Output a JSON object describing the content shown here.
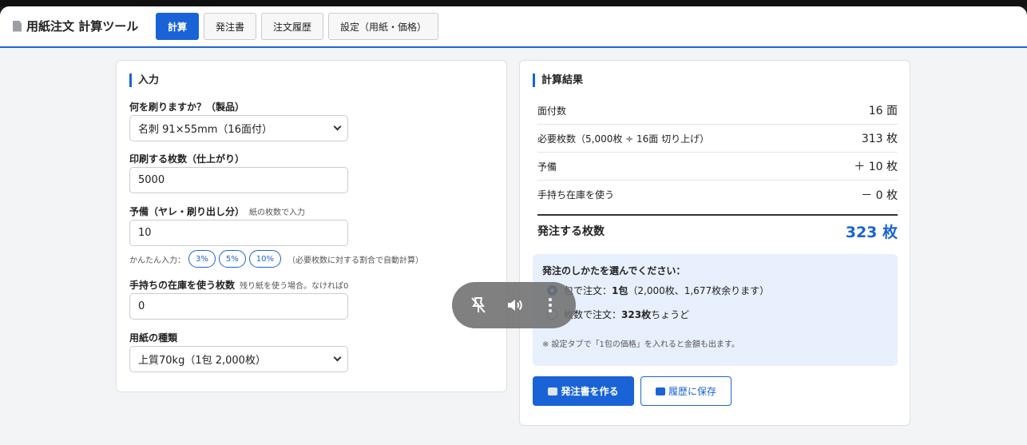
{
  "app": {
    "title": "用紙注文 計算ツール"
  },
  "tabs": [
    {
      "label": "計算",
      "active": true
    },
    {
      "label": "発注書",
      "active": false
    },
    {
      "label": "注文履歴",
      "active": false
    },
    {
      "label": "設定（用紙・価格）",
      "active": false
    }
  ],
  "input": {
    "title": "入力",
    "product_label": "何を刷りますか？（製品）",
    "product_value": "名刺 91×55mm（16面付）",
    "qty_label": "印刷する枚数（仕上がり）",
    "qty_value": "5000",
    "spare_label": "予備（ヤレ・刷り出し分）",
    "spare_hint": "紙の枚数で入力",
    "spare_value": "10",
    "quick_label": "かんたん入力：",
    "quick_options": [
      "3%",
      "5%",
      "10%"
    ],
    "quick_note": "（必要枚数に対する割合で自動計算）",
    "stock_label": "手持ちの在庫を使う枚数",
    "stock_hint": "残り紙を使う場合。なければ0",
    "stock_value": "0",
    "paper_label": "用紙の種類",
    "paper_value": "上質70kg（1包 2,000枚）"
  },
  "result": {
    "title": "計算結果",
    "rows": [
      {
        "label": "面付数",
        "value": "16 面"
      },
      {
        "label": "必要枚数（5,000枚 ÷ 16面 切り上げ）",
        "value": "313 枚"
      },
      {
        "label": "予備",
        "value": "＋ 10 枚"
      },
      {
        "label": "手持ち在庫を使う",
        "value": "－ 0 枚"
      }
    ],
    "total_label": "発注する枚数",
    "total_value": "323 枚",
    "order_title": "発注のしかたを選んでください：",
    "option_pack_prefix": "包で注文：",
    "option_pack_bold": "1包",
    "option_pack_suffix": "（2,000枚、1,677枚余ります）",
    "option_sheet_prefix": "枚数で注文：",
    "option_sheet_bold": "323枚",
    "option_sheet_suffix": "ちょうど",
    "note": "※ 設定タブで「1包の価格」を入れると金額も出ます。",
    "btn_create": "発注書を作る",
    "btn_save": "履歴に保存"
  },
  "media_controls": {
    "icons": [
      "pin-off-icon",
      "speaker-icon",
      "more-vertical-icon"
    ]
  },
  "colors": {
    "accent": "#1a63d6",
    "order_box": "#e8f0fd"
  }
}
